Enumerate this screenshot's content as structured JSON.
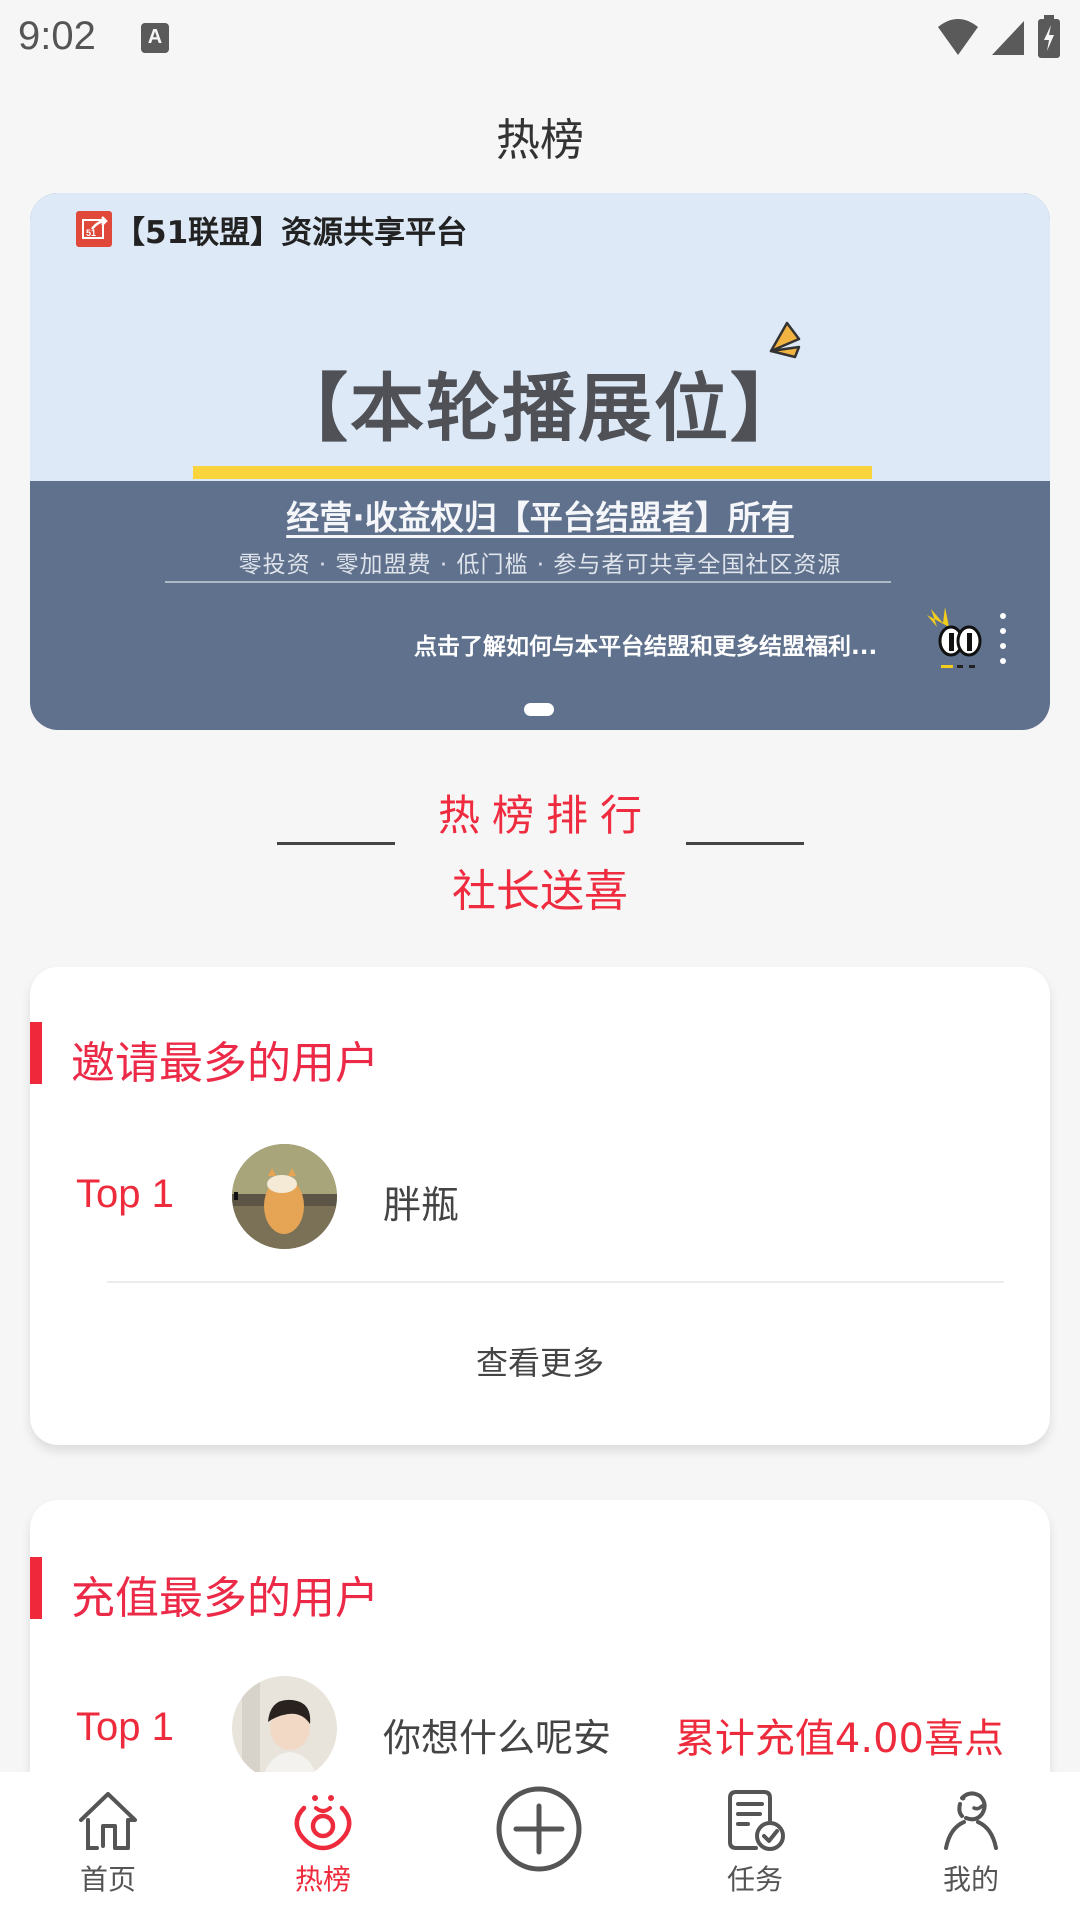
{
  "status_bar": {
    "time": "9:02",
    "notification_icon": "A",
    "icons": [
      "wifi-icon",
      "signal-icon",
      "battery-charging-icon"
    ]
  },
  "header": {
    "title": "热榜"
  },
  "banner": {
    "brand": "【51联盟】资源共享平台",
    "headline": "【本轮播展位】",
    "subtitle": "经营·收益权归【平台结盟者】所有",
    "tagline": "零投资 · 零加盟费 · 低门槛 · 参与者可共享全国社区资源",
    "cta": "点击了解如何与本平台结盟和更多结盟福利...",
    "colors": {
      "top": "#dde9f7",
      "bottom": "#5f718c",
      "accent": "#fad43c"
    },
    "page_count": 1,
    "active_page": 1
  },
  "ranking": {
    "title": "热榜排行",
    "subtitle": "社长送喜"
  },
  "cards": [
    {
      "title": "邀请最多的用户",
      "rows": [
        {
          "rank": "Top 1",
          "name": "胖瓶",
          "value": "",
          "avatar": "corgi-avatar"
        }
      ],
      "more_label": "查看更多"
    },
    {
      "title": "充值最多的用户",
      "rows": [
        {
          "rank": "Top 1",
          "name": "你想什么呢安",
          "value": "累计充值4.00喜点",
          "avatar": "person-avatar"
        }
      ]
    }
  ],
  "bottom_nav": {
    "items": [
      {
        "label": "首页",
        "icon": "home-icon",
        "active": false
      },
      {
        "label": "热榜",
        "icon": "hot-list-icon",
        "active": true
      },
      {
        "label": "",
        "icon": "add-circle-icon",
        "active": false
      },
      {
        "label": "任务",
        "icon": "task-icon",
        "active": false
      },
      {
        "label": "我的",
        "icon": "profile-icon",
        "active": false
      }
    ]
  },
  "colors": {
    "accent_red": "#ee2b3c",
    "background": "#f6f6f6"
  }
}
